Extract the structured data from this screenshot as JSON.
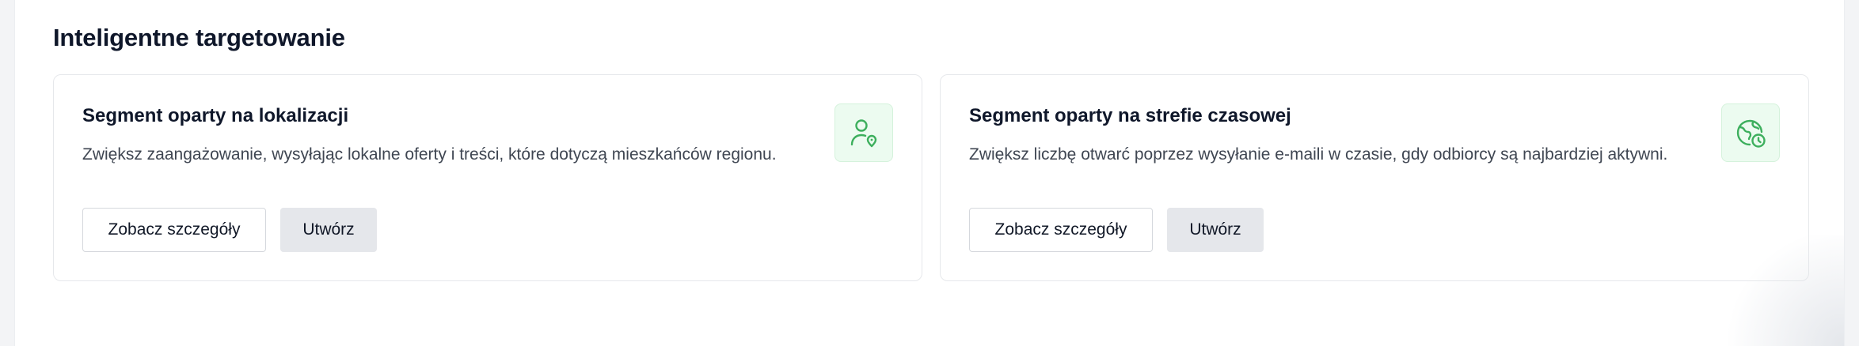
{
  "section": {
    "title": "Inteligentne targetowanie"
  },
  "cards": [
    {
      "title": "Segment oparty na lokalizacji",
      "description": "Zwiększ zaangażowanie, wysyłając lokalne oferty i treści, które dotyczą mieszkańców regionu.",
      "icon": "user-location-icon",
      "details_label": "Zobacz szczegóły",
      "create_label": "Utwórz"
    },
    {
      "title": "Segment oparty na strefie czasowej",
      "description": "Zwiększ liczbę otwarć poprzez wysyłanie e-maili w czasie, gdy odbiorcy są najbardziej aktywni.",
      "icon": "globe-clock-icon",
      "details_label": "Zobacz szczegóły",
      "create_label": "Utwórz"
    }
  ],
  "colors": {
    "accent": "#3daf5d",
    "icon_background": "#ecfbf0",
    "secondary_button": "#e5e7eb"
  }
}
